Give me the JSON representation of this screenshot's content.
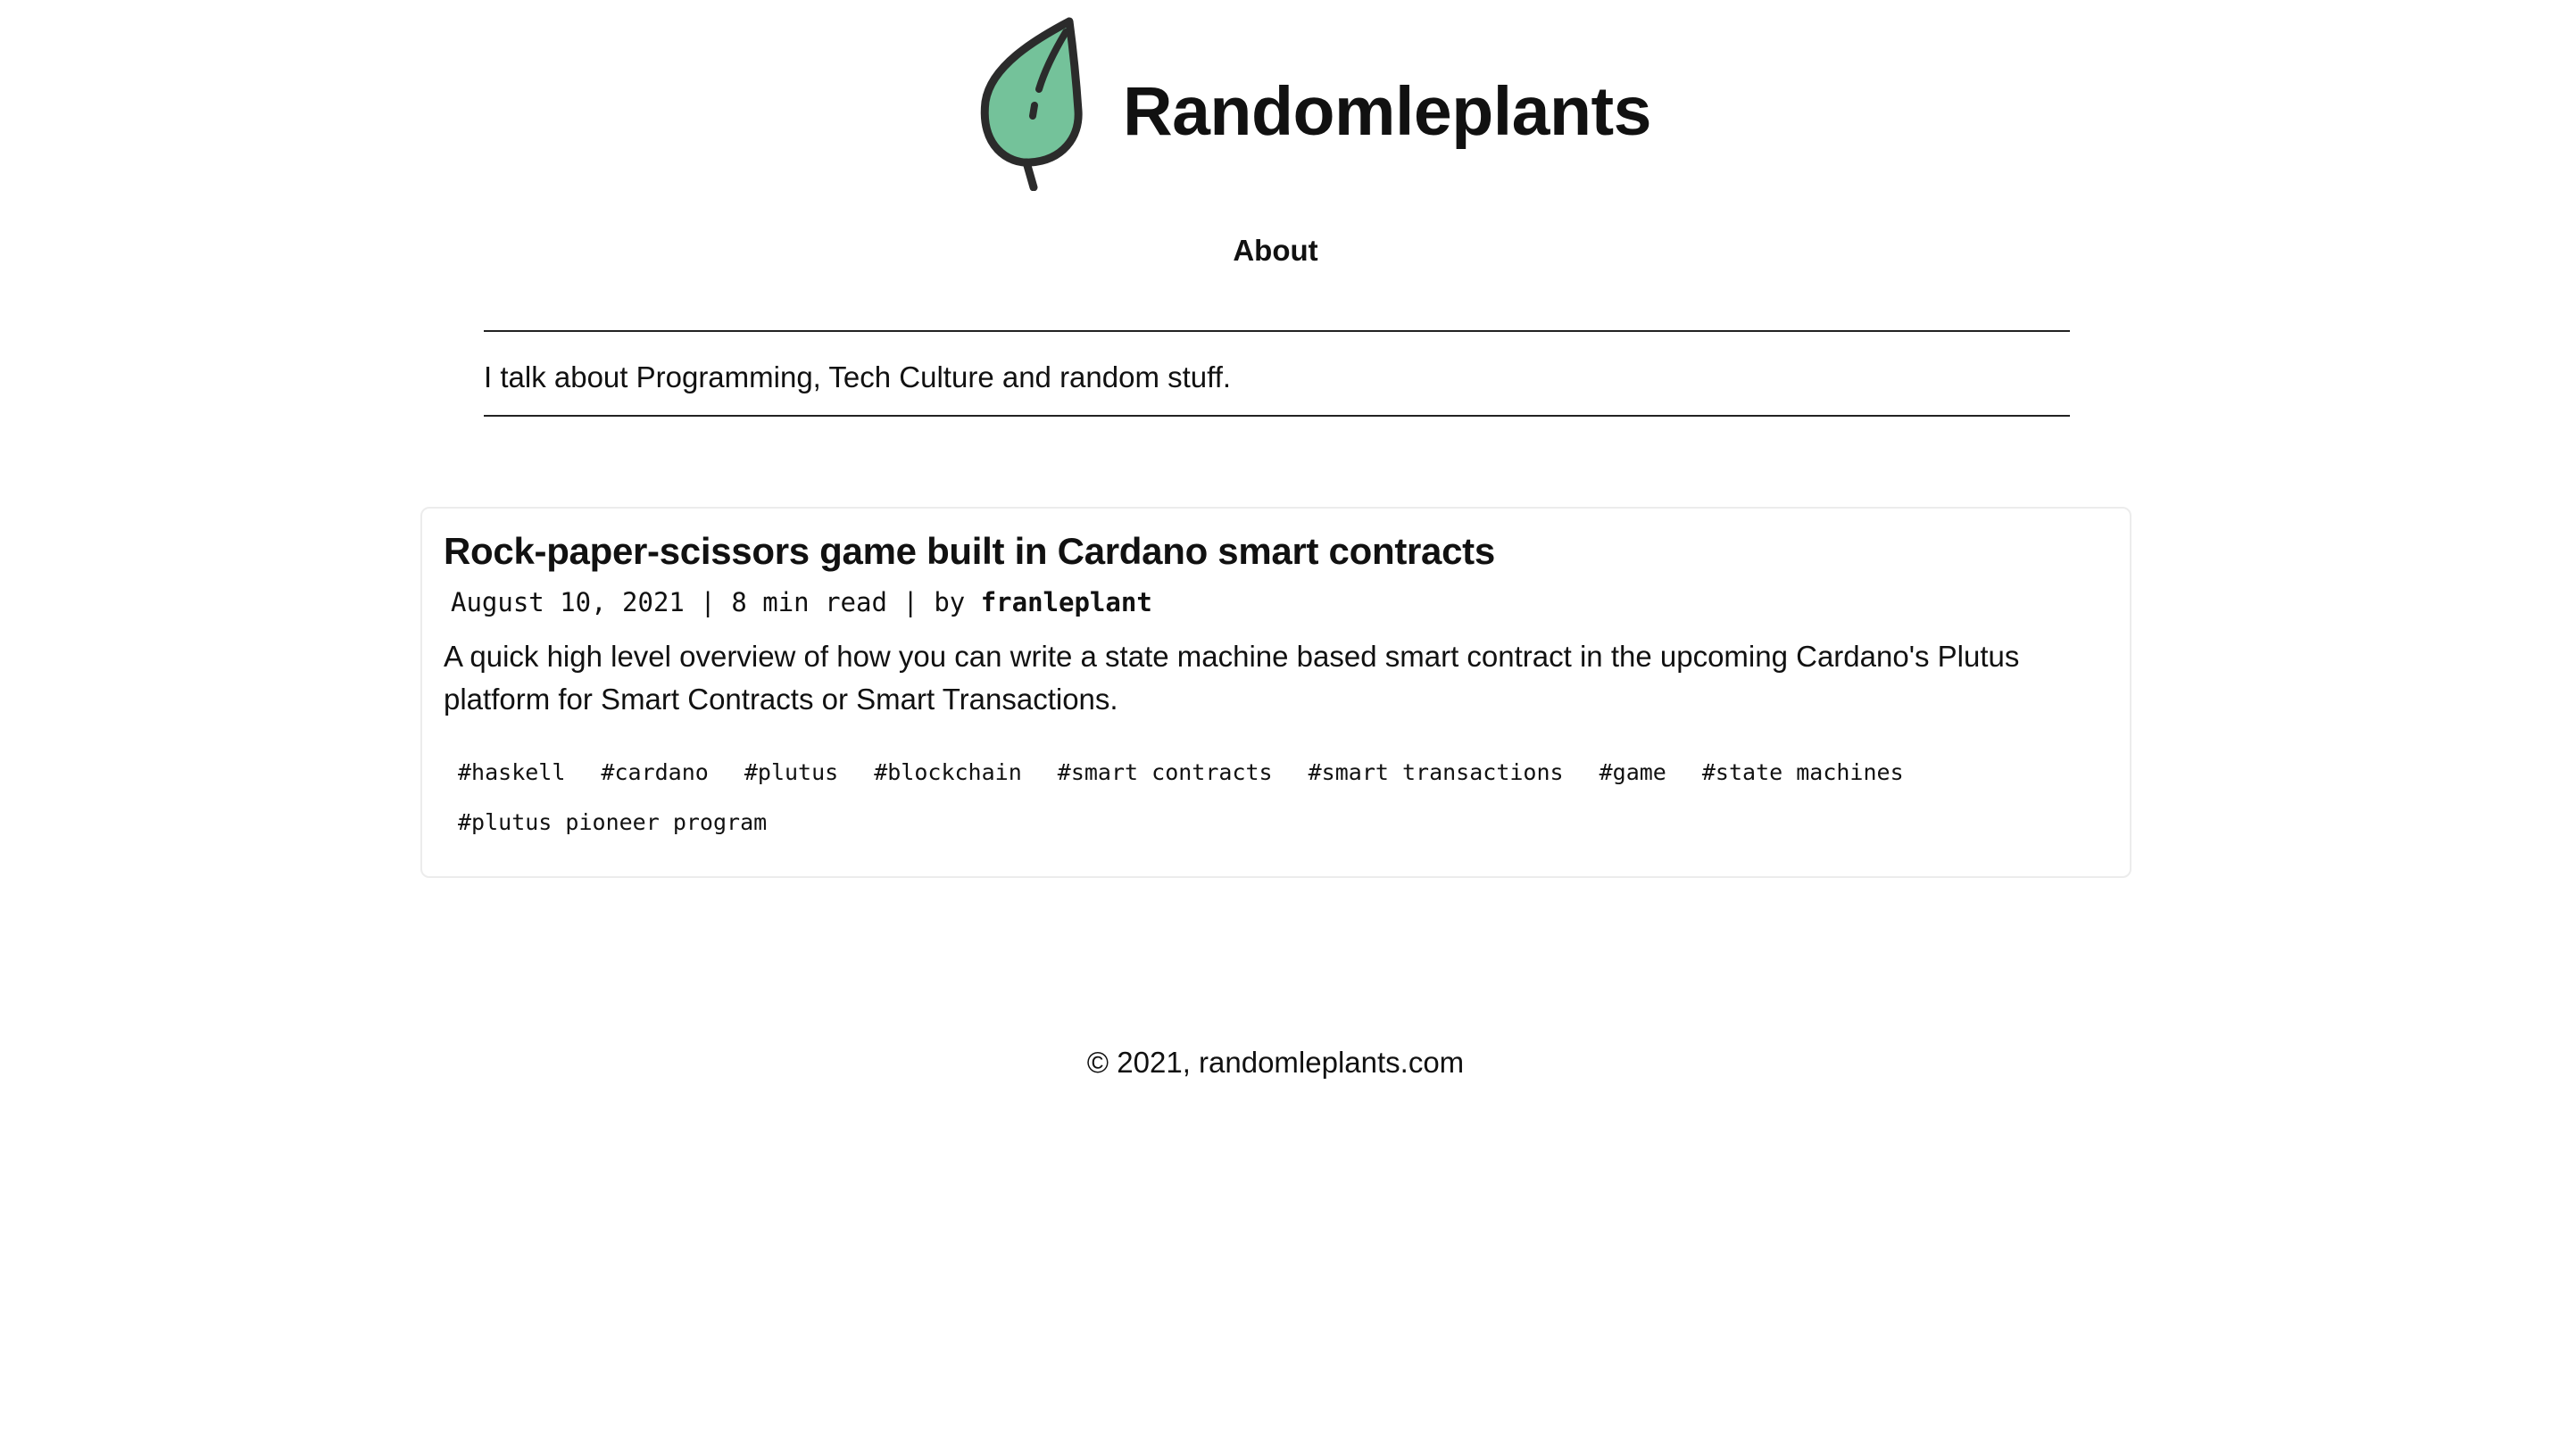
{
  "site": {
    "title": "Randomleplants",
    "logo_icon": "leaf-icon",
    "logo_colors": {
      "fill": "#74c29a",
      "stroke": "#2b2b2b"
    }
  },
  "nav": {
    "items": [
      {
        "label": "About"
      }
    ]
  },
  "bio": {
    "text": "I talk about Programming, Tech Culture and random stuff."
  },
  "posts": [
    {
      "title": "Rock-paper-scissors game built in Cardano smart contracts",
      "date": "August 10, 2021",
      "separator": "|",
      "read_time": "8 min read",
      "by": "by",
      "author": "franleplant",
      "excerpt": "A quick high level overview of how you can write a state machine based smart contract in the upcoming Cardano's Plutus platform for Smart Contracts or Smart Transactions.",
      "tags": [
        "#haskell",
        "#cardano",
        "#plutus",
        "#blockchain",
        "#smart contracts",
        "#smart transactions",
        "#game",
        "#state machines",
        "#plutus pioneer program"
      ]
    }
  ],
  "footer": {
    "text": "© 2021, randomleplants.com"
  }
}
